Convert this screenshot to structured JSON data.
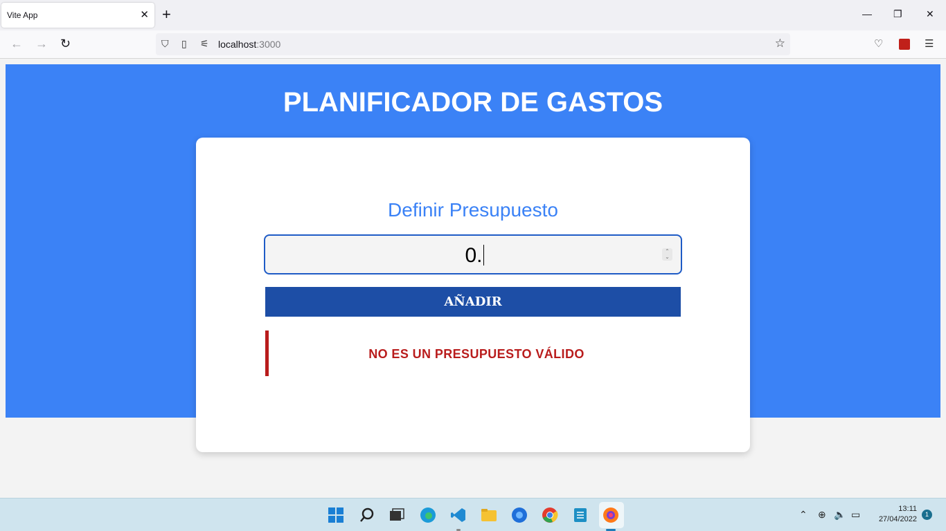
{
  "browser": {
    "tab_title": "Vite App",
    "url_host": "localhost",
    "url_port": ":3000"
  },
  "app": {
    "title": "PLANIFICADOR DE GASTOS",
    "form_label": "Definir Presupuesto",
    "input_value": "0.",
    "add_button": "AÑADIR",
    "error_message": "NO ES UN PRESUPUESTO VÁLIDO"
  },
  "taskbar": {
    "time": "13:11",
    "date": "27/04/2022",
    "notification_count": "1"
  },
  "colors": {
    "hero_bg": "#3b82f6",
    "button_bg": "#1d4ea6",
    "error": "#b91c1c"
  }
}
